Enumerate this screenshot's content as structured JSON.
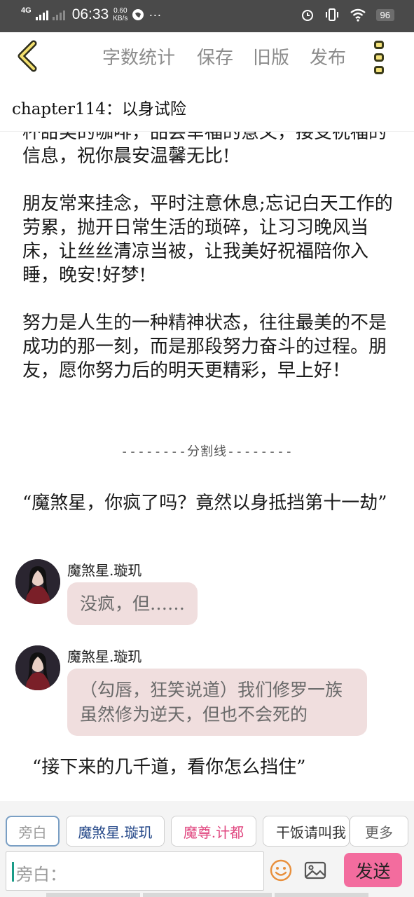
{
  "status_bar": {
    "network": "4G",
    "time": "06:33",
    "speed_value": "0.60",
    "speed_unit": "KB/s",
    "more": "···",
    "battery": "96"
  },
  "toolbar": {
    "word_count": "字数统计",
    "save": "保存",
    "old_version": "旧版",
    "publish": "发布"
  },
  "chapter_title": "chapter114：以身试险",
  "paragraphs": [
    "杯甜美的咖啡，品尝幸福的意义，接受祝福的信息，祝你晨安温馨无比!",
    "朋友常来挂念，平时注意休息;忘记白天工作的劳累，抛开日常生活的琐碎，让习习晚风当床，让丝丝清凉当被，让我美好祝福陪你入睡，晚安!好梦!",
    "努力是人生的一种精神状态，往往最美的不是成功的那一刻，而是那段努力奋斗的过程。朋友，愿你努力后的明天更精彩，早上好！"
  ],
  "divider": "--------分割线--------",
  "quote_1": "“魔煞星，你疯了吗？竟然以身抵挡第十一劫”",
  "messages": [
    {
      "speaker": "魔煞星.璇玑",
      "text": "没疯，但……"
    },
    {
      "speaker": "魔煞星.璇玑",
      "text": "（勾唇，狂笑说道）我们修罗一族虽然修为逆天，但也不会死的"
    }
  ],
  "quote_2": "“接下来的几千道，看你怎么挡住”",
  "composer": {
    "roles": [
      "旁白",
      "魔煞星.璇玑",
      "魔尊.计都",
      "干饭请叫我"
    ],
    "more": "更多",
    "placeholder": "旁白：",
    "send": "发送"
  },
  "colors": {
    "status_bar": "#4a4a4a",
    "bubble": "#f0dede",
    "send_button": "#f36c9e",
    "role_pink": "#e0467f",
    "role_blue": "#274a8a"
  },
  "icons": [
    "back-arrow-icon",
    "more-menu-icon",
    "emoji-icon",
    "image-icon",
    "alarm-icon",
    "vibrate-icon",
    "wifi-icon"
  ]
}
